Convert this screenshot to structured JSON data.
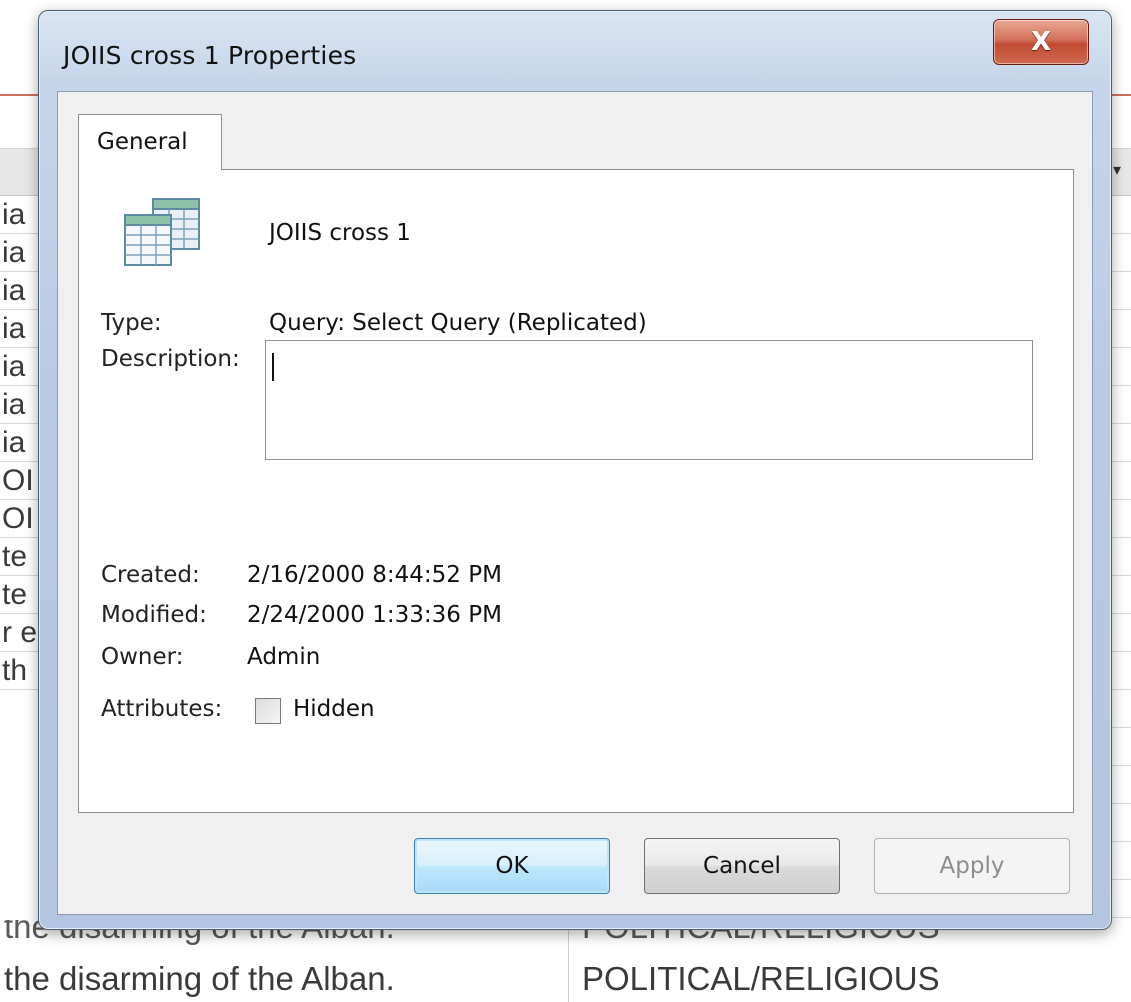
{
  "dialog": {
    "title": "JOIIS cross 1 Properties",
    "close_label": "X",
    "tab_label": "General",
    "object_name": "JOIIS cross 1",
    "type_label": "Type:",
    "type_value": "Query: Select Query (Replicated)",
    "description_label": "Description:",
    "description_value": "",
    "created_label": "Created:",
    "created_value": "2/16/2000 8:44:52 PM",
    "modified_label": "Modified:",
    "modified_value": "2/24/2000 1:33:36 PM",
    "owner_label": "Owner:",
    "owner_value": "Admin",
    "attributes_label": "Attributes:",
    "hidden_label": "Hidden",
    "hidden_checked": false,
    "ok_label": "OK",
    "cancel_label": "Cancel",
    "apply_label": "Apply"
  },
  "background": {
    "row_fragments": [
      "ia",
      "ia",
      "ia",
      "ia",
      "ia",
      "ia",
      "ia",
      "OI",
      "OI",
      "te",
      "te",
      "r e",
      "th"
    ],
    "partial_row": {
      "col1": "the disarming of the Alban.",
      "col2": "POLITICAL/RELIGIOUS"
    },
    "bottom_row": {
      "col1": "the disarming of the Alban.",
      "col2": "POLITICAL/RELIGIOUS"
    }
  },
  "colors": {
    "accent_blue": "#3c7fb1",
    "close_red": "#c24a33",
    "window_frame": "#b9cbe4"
  }
}
